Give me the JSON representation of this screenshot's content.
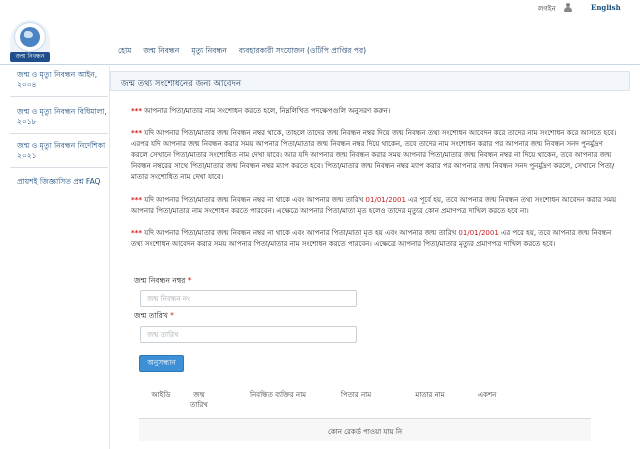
{
  "topbar": {
    "login_label": "লগইন",
    "language_label": "English"
  },
  "logo": {
    "caption": "জন্ম নিবন্ধন"
  },
  "nav": {
    "items": [
      {
        "label": "হোম"
      },
      {
        "label": "জন্ম নিবন্ধন"
      },
      {
        "label": "মৃত্যু নিবন্ধন"
      },
      {
        "label": "ব্যবহারকারী সংযোজন (ওটিপি প্রাপ্তির পর)"
      }
    ]
  },
  "sidebar": {
    "items": [
      {
        "label": "জন্ম ও মৃত্যু নিবন্ধন আইন, ২০০৪"
      },
      {
        "label": "জন্ম ও মৃত্যু নিবন্ধন বিধিমালা, ২০১৮"
      },
      {
        "label": "জন্ম ও মৃত্যু নিবন্ধন নির্দেশিকা ২০২১"
      },
      {
        "label": "প্রায়শই জিজ্ঞাসিত প্রশ্ন FAQ"
      }
    ]
  },
  "main": {
    "title": "জন্ম তথ্য সংশোধনের জন্য আবেদন",
    "stars": "***",
    "intro": " আপনার পিতা/মাতার নাম সংশোধন করতে হলে, নিম্নলিখিত পদক্ষেপগুলি অনুসরণ করুন।",
    "rule1": " যদি আপনার পিতা/মাতার জন্ম নিবন্ধন নম্বর থাকে, তাহলে তাদের জন্ম নিবন্ধন নম্বর দিয়ে জন্ম নিবন্ধন তথ্য সংশোধন আবেদন করে তাদের নাম সংশোধন করে আসতে হবে। এরপর যদি আপনার জন্ম নিবন্ধন করার সময় আপনার পিতা/মাতার জন্ম নিবন্ধন নম্বর দিয়ে থাকেন, তবে তাদের নাম সংশোধন করার পর আপনার জন্ম নিবন্ধন সনদ পুনর্মুদ্রণ করলে সেখানে পিতা/মাতার সংশোধিত নাম দেখা যাবে। আর যদি আপনার জন্ম নিবন্ধন করার সময় আপনার পিতা/মাতার জন্ম নিবন্ধন নম্বর না দিয়ে থাকেন, তবে আপনার জন্ম নিবন্ধন নম্বরের সাথে পিতা/মাতার জন্ম নিবন্ধন নম্বর ম্যাপ করতে হবে। পিতা/মাতার জন্ম নিবন্ধন নম্বর ম্যাপ করার পর আপনার জন্ম নিবন্ধন সনদ পুনর্মুদ্রণ করলে, সেখানে পিতা/মাতার সংশোধিত নাম দেখা যাবে।",
    "rule2_a": " যদি আপনার পিতা/মাতার জন্ম নিবন্ধন নম্বর না থাকে এবং আপনার জন্ম তারিখ ",
    "rule2_date": "01/01/2001",
    "rule2_b": " এর পূর্বে হয়, তবে আপনার জন্ম নিবন্ধন তথ্য সংশোধন আবেদন করার সময় আপনার পিতা/মাতার নাম সংশোধন করতে পারবেন। এক্ষেত্রে আপনার পিতা/মাতা মৃত হলেও তাদের মৃত্যুর কোন প্রমাণপত্র দাখিল করতে হবে না।",
    "rule3_a": " যদি আপনার পিতা/মাতার জন্ম নিবন্ধন নম্বর না থাকে এবং আপনার পিতা/মাতা মৃত হয় এবং আপনার জন্ম তারিখ ",
    "rule3_date": "01/01/2001",
    "rule3_b": " এর পরে হয়, তবে আপনার জন্ম নিবন্ধন তথ্য সংশোধন আবেদন করার সময় আপনার পিতা/মাতার নাম সংশোধন করতে পারবেন। এক্ষেত্রে আপনার পিতা/মাতার মৃত্যুর প্রমাণপত্র দাখিল করতে হবে।"
  },
  "form": {
    "reg_label": "জন্ম নিবন্ধন নম্বর",
    "reg_placeholder": "জন্ম নিবন্ধন নং",
    "dob_label": "জন্ম তারিখ",
    "dob_placeholder": "জন্ম তারিখ",
    "required_mark": "*",
    "search_label": "অনুসন্ধান"
  },
  "table": {
    "headers": [
      {
        "label": "আইডি"
      },
      {
        "label": "জন্ম তারিখ"
      },
      {
        "label": "নিবন্ধিত ব্যক্তির নাম"
      },
      {
        "label": "পিতার নাম"
      },
      {
        "label": "মাতার নাম"
      },
      {
        "label": "একশন"
      }
    ],
    "empty_message": "কোন রেকর্ড পাওয়া যায় নি"
  },
  "colors": {
    "accent": "#3d8fd6",
    "link": "#1f4e80",
    "warning": "#d01e1e"
  }
}
